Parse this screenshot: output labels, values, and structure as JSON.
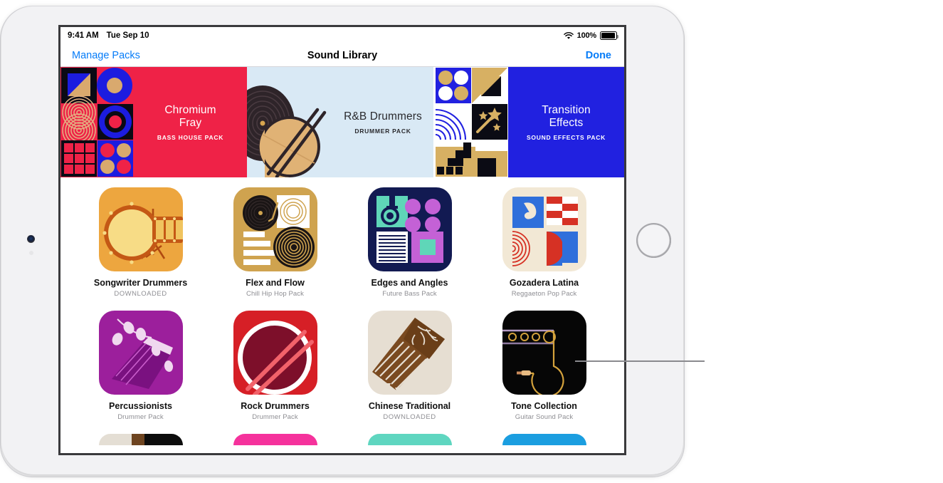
{
  "status_bar": {
    "time": "9:41 AM",
    "date": "Tue Sep 10",
    "battery_percent": "100%",
    "wifi_icon": "wifi-icon",
    "battery_icon": "battery-full-icon"
  },
  "nav_bar": {
    "left_button": "Manage Packs",
    "title": "Sound Library",
    "right_button": "Done"
  },
  "featured": [
    {
      "title": "Chromium Fray",
      "title_line1": "Chromium",
      "title_line2": "Fray",
      "subtitle": "BASS HOUSE PACK",
      "bg_color": "#ef2247",
      "text_color": "#ffffff",
      "art_name": "chromium-fray-artwork"
    },
    {
      "title": "R&B Drummers",
      "title_line1": "R&B Drummers",
      "title_line2": "",
      "subtitle": "DRUMMER PACK",
      "bg_color": "#d9e9f5",
      "text_color": "#2a2a2e",
      "art_name": "rnb-drummers-artwork"
    },
    {
      "title": "Transition Effects",
      "title_line1": "Transition",
      "title_line2": "Effects",
      "subtitle": "SOUND EFFECTS PACK",
      "bg_color": "#2121e0",
      "text_color": "#ffffff",
      "art_name": "transition-effects-artwork"
    }
  ],
  "packs": [
    {
      "name": "Songwriter Drummers",
      "sub": "DOWNLOADED",
      "downloaded": true,
      "art_name": "songwriter-drummers-artwork"
    },
    {
      "name": "Flex and Flow",
      "sub": "Chill Hip Hop Pack",
      "downloaded": false,
      "art_name": "flex-and-flow-artwork"
    },
    {
      "name": "Edges and Angles",
      "sub": "Future Bass Pack",
      "downloaded": false,
      "art_name": "edges-and-angles-artwork"
    },
    {
      "name": "Gozadera Latina",
      "sub": "Reggaeton Pop Pack",
      "downloaded": false,
      "art_name": "gozadera-latina-artwork"
    },
    {
      "name": "Percussionists",
      "sub": "Drummer Pack",
      "downloaded": false,
      "art_name": "percussionists-artwork"
    },
    {
      "name": "Rock Drummers",
      "sub": "Drummer Pack",
      "downloaded": false,
      "art_name": "rock-drummers-artwork"
    },
    {
      "name": "Chinese Traditional",
      "sub": "DOWNLOADED",
      "downloaded": true,
      "art_name": "chinese-traditional-artwork"
    },
    {
      "name": "Tone Collection",
      "sub": "Guitar Sound Pack",
      "downloaded": false,
      "art_name": "tone-collection-artwork"
    }
  ],
  "partial_row_colors": [
    "#1c1c1e",
    "#f5329c",
    "#5fd6c0",
    "#1b9ee0"
  ],
  "colors": {
    "accent_blue": "#067cf8",
    "secondary_text": "#8e8e93",
    "callout_line": "#8a8a8e",
    "screen_background": "#ffffff"
  }
}
